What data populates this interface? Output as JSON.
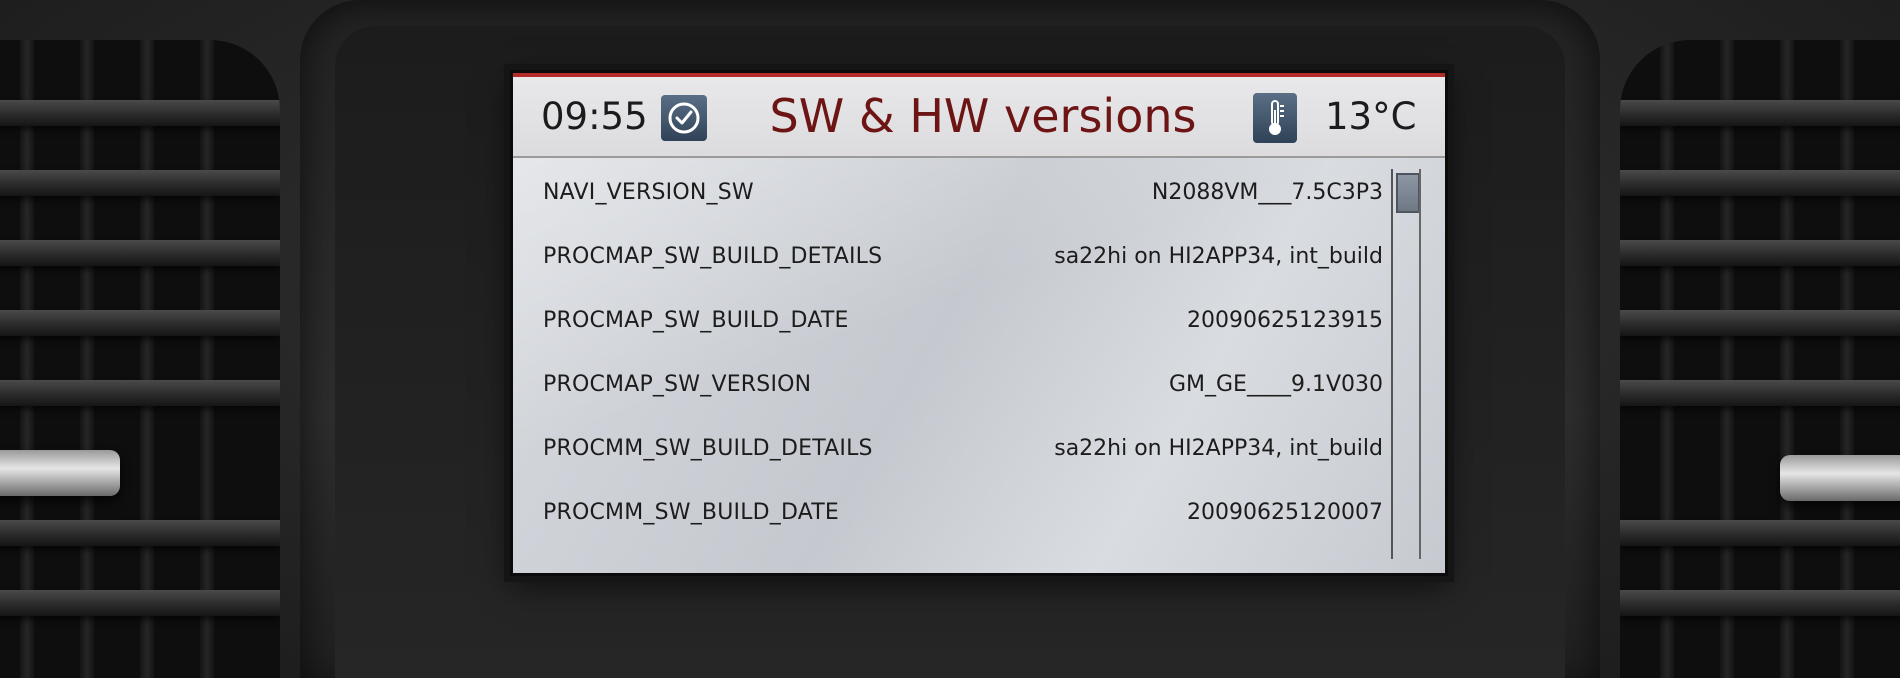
{
  "header": {
    "time": "09:55",
    "title": "SW & HW versions",
    "temperature": "13°C",
    "clock_icon": "clock-icon",
    "thermometer_icon": "thermometer-icon",
    "accent_color": "#b22a2a",
    "title_color": "#6d1414"
  },
  "rows": [
    {
      "key": "NAVI_VERSION_SW",
      "value": "N2088VM___7.5C3P3"
    },
    {
      "key": "PROCMAP_SW_BUILD_DETAILS",
      "value": "sa22hi on HI2APP34, int_build"
    },
    {
      "key": "PROCMAP_SW_BUILD_DATE",
      "value": "20090625123915"
    },
    {
      "key": "PROCMAP_SW_VERSION",
      "value": "GM_GE____9.1V030"
    },
    {
      "key": "PROCMM_SW_BUILD_DETAILS",
      "value": "sa22hi on HI2APP34, int_build"
    },
    {
      "key": "PROCMM_SW_BUILD_DATE",
      "value": "20090625120007"
    }
  ],
  "scrollbar": {
    "position_fraction": 0.0
  }
}
